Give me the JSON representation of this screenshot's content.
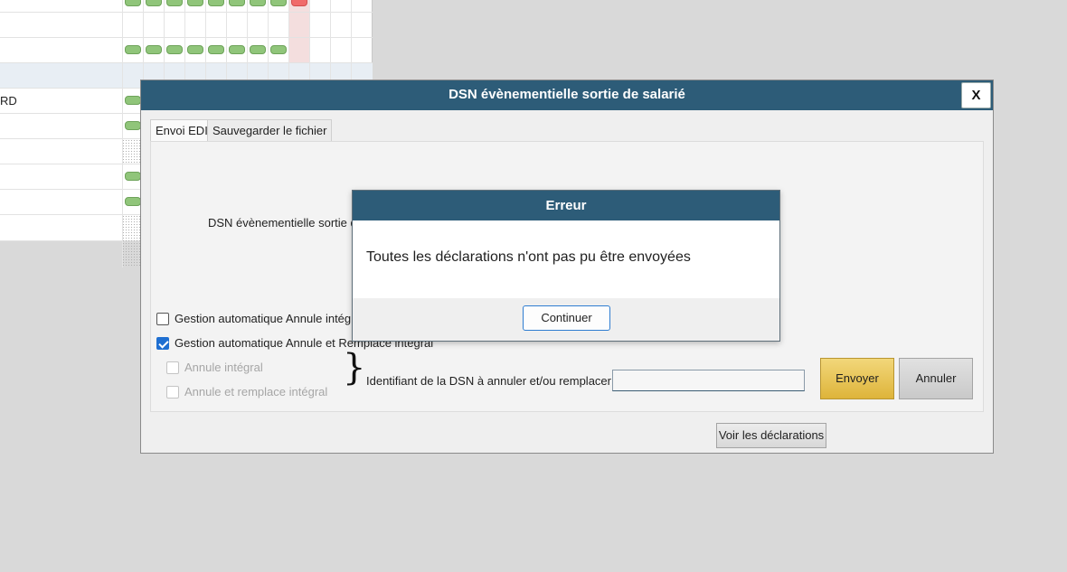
{
  "background": {
    "row_label": "RD"
  },
  "dialog": {
    "title": "DSN évènementielle sortie de salarié",
    "close_label": "X",
    "tabs": [
      {
        "label": "Envoi EDI",
        "active": true
      },
      {
        "label": "Sauvegarder le fichier",
        "active": false
      }
    ],
    "panel_label": "DSN évènementielle sortie de s",
    "checkboxes": {
      "annule_integral_auto": {
        "label": "Gestion automatique Annule intégral",
        "checked": false
      },
      "annule_remplace_auto": {
        "label": "Gestion automatique Annule et Remplace intégral",
        "checked": true
      },
      "annule_integral": {
        "label": "Annule intégral",
        "checked": false,
        "disabled": true
      },
      "annule_remplace": {
        "label": "Annule et remplace intégral",
        "checked": false,
        "disabled": true
      }
    },
    "identifiant_label": "Identifiant de la DSN à annuler et/ou remplacer :",
    "identifiant_value": "",
    "envoyer_label": "Envoyer",
    "annuler_label": "Annuler",
    "voir_label": "Voir les déclarations"
  },
  "error": {
    "title": "Erreur",
    "message": "Toutes les déclarations n'ont pas pu être envoyées",
    "button_label": "Continuer"
  },
  "colors": {
    "titlebar": "#2d5c78",
    "accent_yellow": "#deb43a",
    "checkbox_blue": "#1f6fd1",
    "status_green": "#90c57a",
    "status_red": "#f06b6b"
  }
}
